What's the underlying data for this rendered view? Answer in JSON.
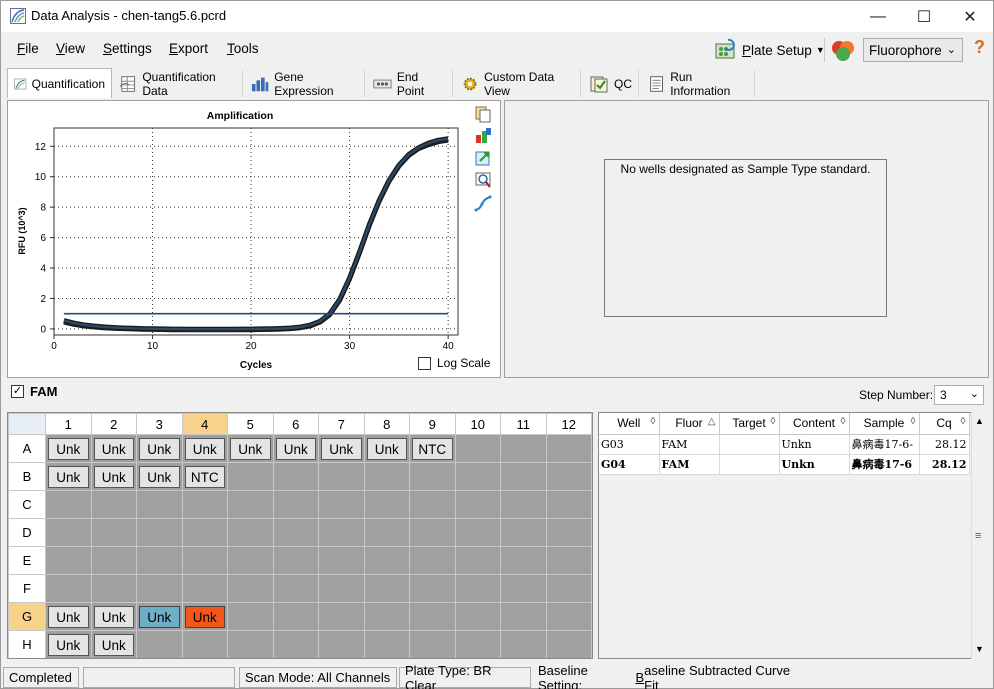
{
  "window": {
    "title": "Data Analysis - chen-tang5.6.pcrd",
    "minimize": "—",
    "maximize": "☐",
    "close": "✕"
  },
  "menu": {
    "file": "File",
    "view": "View",
    "settings": "Settings",
    "export": "Export",
    "tools": "Tools"
  },
  "toolbar": {
    "plate_setup": "Plate Setup",
    "fluorophore": "Fluorophore",
    "help": "?"
  },
  "tabs": [
    {
      "label": "Quantification",
      "icon": "amplification-icon"
    },
    {
      "label": "Quantification Data",
      "icon": "table-icon"
    },
    {
      "label": "Gene Expression",
      "icon": "bar-chart-icon"
    },
    {
      "label": "End Point",
      "icon": "end-point-icon"
    },
    {
      "label": "Custom Data View",
      "icon": "gear-icon"
    },
    {
      "label": "QC",
      "icon": "qc-icon"
    },
    {
      "label": "Run Information",
      "icon": "document-icon"
    }
  ],
  "chart_data": {
    "type": "line",
    "title": "Amplification",
    "xlabel": "Cycles",
    "ylabel": "RFU (10^3)",
    "xlim": [
      0,
      41
    ],
    "ylim": [
      -0.4,
      13.2
    ],
    "xticks": [
      0,
      10,
      20,
      30,
      40
    ],
    "yticks": [
      0,
      2,
      4,
      6,
      8,
      10,
      12
    ],
    "grid": true,
    "threshold": 1.0,
    "series": [
      {
        "x": [
          1,
          2,
          3,
          4,
          5,
          6,
          7,
          8,
          9,
          10,
          11,
          12,
          13,
          14,
          15,
          16,
          17,
          18,
          19,
          20,
          21,
          22,
          23,
          24,
          25,
          26,
          27,
          28,
          29,
          30,
          31,
          32,
          33,
          34,
          35,
          36,
          37,
          38,
          39,
          40
        ],
        "y": [
          0.45,
          0.3,
          0.2,
          0.13,
          0.08,
          0.04,
          0.02,
          0.0,
          -0.02,
          -0.03,
          -0.04,
          -0.05,
          -0.05,
          -0.06,
          -0.06,
          -0.06,
          -0.06,
          -0.06,
          -0.05,
          -0.05,
          -0.04,
          -0.03,
          -0.01,
          0.02,
          0.08,
          0.2,
          0.45,
          0.95,
          1.9,
          3.3,
          5.0,
          6.8,
          8.4,
          9.7,
          10.7,
          11.4,
          11.85,
          12.1,
          12.3,
          12.4
        ]
      },
      {
        "x": [
          1,
          2,
          3,
          4,
          5,
          6,
          7,
          8,
          9,
          10,
          11,
          12,
          13,
          14,
          15,
          16,
          17,
          18,
          19,
          20,
          21,
          22,
          23,
          24,
          25,
          26,
          27,
          28,
          29,
          30,
          31,
          32,
          33,
          34,
          35,
          36,
          37,
          38,
          39,
          40
        ],
        "y": [
          0.55,
          0.38,
          0.27,
          0.19,
          0.13,
          0.09,
          0.06,
          0.04,
          0.02,
          0.01,
          0.0,
          -0.01,
          -0.01,
          -0.02,
          -0.02,
          -0.02,
          -0.02,
          -0.02,
          -0.01,
          -0.01,
          0.0,
          0.01,
          0.03,
          0.06,
          0.12,
          0.25,
          0.5,
          1.0,
          1.95,
          3.35,
          5.05,
          6.85,
          8.45,
          9.75,
          10.75,
          11.45,
          11.9,
          12.2,
          12.4,
          12.5
        ]
      }
    ],
    "log_scale_label": "Log Scale"
  },
  "standard_panel": {
    "message": "No wells designated as Sample Type standard."
  },
  "fluor_bar": {
    "fluor": "FAM",
    "step_label": "Step Number:",
    "step_value": "3"
  },
  "plate": {
    "columns": [
      "1",
      "2",
      "3",
      "4",
      "5",
      "6",
      "7",
      "8",
      "9",
      "10",
      "11",
      "12"
    ],
    "rows": [
      {
        "label": "A",
        "wells": [
          "Unk",
          "Unk",
          "Unk",
          "Unk",
          "Unk",
          "Unk",
          "Unk",
          "Unk",
          "NTC",
          "",
          "",
          ""
        ]
      },
      {
        "label": "B",
        "wells": [
          "Unk",
          "Unk",
          "Unk",
          "NTC",
          "",
          "",
          "",
          "",
          "",
          "",
          "",
          ""
        ]
      },
      {
        "label": "C",
        "wells": [
          "",
          "",
          "",
          "",
          "",
          "",
          "",
          "",
          "",
          "",
          "",
          ""
        ]
      },
      {
        "label": "D",
        "wells": [
          "",
          "",
          "",
          "",
          "",
          "",
          "",
          "",
          "",
          "",
          "",
          ""
        ]
      },
      {
        "label": "E",
        "wells": [
          "",
          "",
          "",
          "",
          "",
          "",
          "",
          "",
          "",
          "",
          "",
          ""
        ]
      },
      {
        "label": "F",
        "wells": [
          "",
          "",
          "",
          "",
          "",
          "",
          "",
          "",
          "",
          "",
          "",
          ""
        ]
      },
      {
        "label": "G",
        "wells": [
          "Unk",
          "Unk",
          "Unk",
          "Unk",
          "",
          "",
          "",
          "",
          "",
          "",
          "",
          ""
        ]
      },
      {
        "label": "H",
        "wells": [
          "Unk",
          "Unk",
          "",
          "",
          "",
          "",
          "",
          "",
          "",
          "",
          "",
          ""
        ]
      }
    ],
    "highlight": {
      "blue": "G3",
      "red": "G4"
    }
  },
  "results": {
    "headers": [
      "Well",
      "Fluor",
      "Target",
      "Content",
      "Sample",
      "Cq"
    ],
    "rows": [
      {
        "well": "G03",
        "fluor": "FAM",
        "target": "",
        "content": "Unkn",
        "sample": "鼻病毒17-6-",
        "cq": "28.12"
      },
      {
        "well": "G04",
        "fluor": "FAM",
        "target": "",
        "content": "Unkn",
        "sample": "鼻病毒17-6",
        "cq": "28.12"
      }
    ]
  },
  "status": {
    "state": "Completed",
    "scan_mode": "Scan Mode: All Channels",
    "plate_type": "Plate Type: BR Clear",
    "baseline": "Baseline Setting: Baseline Subtracted Curve Fit"
  },
  "colors": {
    "curve": "#2a4a6a",
    "curve_outline": "#1a1a1a",
    "threshold": "#1f4f7f",
    "selected_well_blue": "#6eafc6",
    "selected_well_red": "#f3561b"
  }
}
